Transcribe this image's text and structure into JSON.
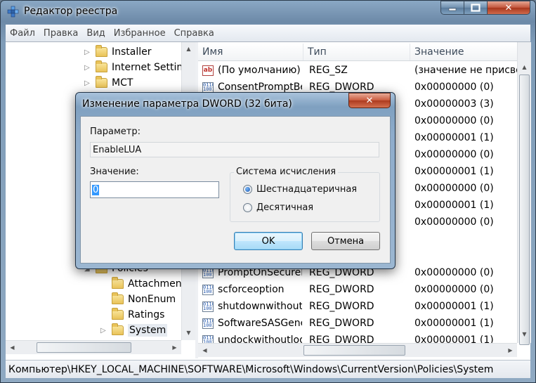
{
  "window": {
    "title": "Редактор реестра"
  },
  "menu": [
    "Файл",
    "Правка",
    "Вид",
    "Избранное",
    "Справка"
  ],
  "tree": {
    "items": [
      {
        "label": "Installer",
        "expandable": true
      },
      {
        "label": "Internet Settings",
        "expandable": true
      },
      {
        "label": "MCT",
        "expandable": true
      },
      {
        "label": "Policies",
        "expandable": false
      },
      {
        "label": "Attachments",
        "expandable": false
      },
      {
        "label": "NonEnum",
        "expandable": false
      },
      {
        "label": "Ratings",
        "expandable": false
      },
      {
        "label": "System",
        "expandable": true,
        "selected": true
      }
    ]
  },
  "list": {
    "columns": [
      "Имя",
      "Тип",
      "Значение"
    ],
    "rows": [
      {
        "icon": "string-value-icon",
        "name": "(По умолчанию)",
        "type": "REG_SZ",
        "value": "(значение не присвоено)"
      },
      {
        "icon": "binary-value-icon",
        "name": "ConsentPromptBehaviorAdmin",
        "type": "REG_DWORD",
        "value": "0x00000000 (0)"
      },
      {
        "icon": "binary-value-icon",
        "name": "ConsentPromptBehaviorUser",
        "type": "REG_DWORD",
        "value": "0x00000003 (3)"
      },
      {
        "icon": "binary-value-icon",
        "name": "",
        "type": "",
        "value": "0x00000000 (0)"
      },
      {
        "icon": "binary-value-icon",
        "name": "",
        "type": "",
        "value": "0x00000001 (1)"
      },
      {
        "icon": "binary-value-icon",
        "name": "",
        "type": "",
        "value": "0x00000000 (0)"
      },
      {
        "icon": "binary-value-icon",
        "name": "",
        "type": "",
        "value": "0x00000001 (1)"
      },
      {
        "icon": "binary-value-icon",
        "name": "",
        "type": "",
        "value": "0x00000000 (0)"
      },
      {
        "icon": "binary-value-icon",
        "name": "",
        "type": "",
        "value": "0x00000001 (1)"
      },
      {
        "icon": "binary-value-icon",
        "name": "",
        "type": "",
        "value": "0x00000000 (0)"
      },
      {
        "icon": "binary-value-icon",
        "name": "PromptOnSecureDesktop",
        "type": "REG_DWORD",
        "value": "0x00000000 (0)"
      },
      {
        "icon": "binary-value-icon",
        "name": "scforceoption",
        "type": "REG_DWORD",
        "value": "0x00000000 (0)"
      },
      {
        "icon": "binary-value-icon",
        "name": "shutdownwithoutlogon",
        "type": "REG_DWORD",
        "value": "0x00000001 (1)"
      },
      {
        "icon": "binary-value-icon",
        "name": "SoftwareSASGeneration",
        "type": "REG_DWORD",
        "value": "0x00000001 (1)"
      },
      {
        "icon": "binary-value-icon",
        "name": "undockwithoutlogon",
        "type": "REG_DWORD",
        "value": "0x00000001 (1)"
      }
    ]
  },
  "status": "Компьютер\\HKEY_LOCAL_MACHINE\\SOFTWARE\\Microsoft\\Windows\\CurrentVersion\\Policies\\System",
  "dialog": {
    "title": "Изменение параметра DWORD (32 бита)",
    "param_label": "Параметр:",
    "param_value": "EnableLUA",
    "value_label": "Значение:",
    "value": "0",
    "base_label": "Система исчисления",
    "base_options": [
      {
        "label": "Шестнадцатеричная",
        "selected": true
      },
      {
        "label": "Десятичная",
        "selected": false
      }
    ],
    "ok_label": "OK",
    "cancel_label": "Отмена"
  }
}
